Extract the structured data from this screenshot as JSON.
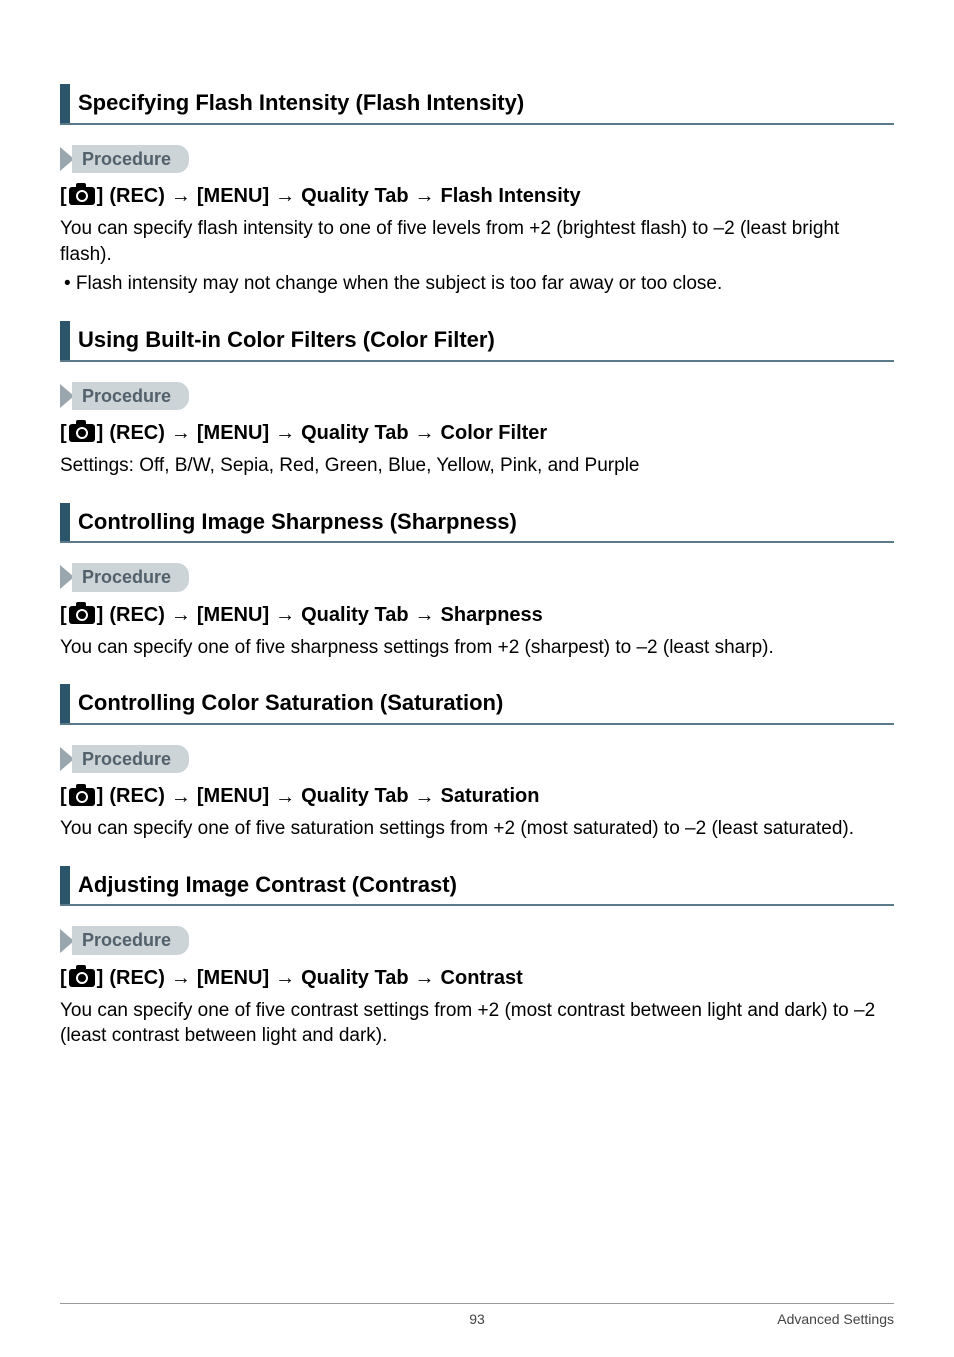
{
  "arrow": "→",
  "rec_bracket_open": "[",
  "rec_bracket_close": "]",
  "rec_label": "(REC)",
  "menu_label": "[MENU]",
  "quality_tab": "Quality Tab",
  "procedure_label": "Procedure",
  "sections": {
    "flash": {
      "title": "Specifying Flash Intensity (Flash Intensity)",
      "path_tail": "Flash Intensity",
      "body1": "You can specify flash intensity to one of five levels from +2 (brightest flash) to –2 (least bright flash).",
      "bullet1": "• Flash intensity may not change when the subject is too far away or too close."
    },
    "filter": {
      "title": "Using Built-in Color Filters (Color Filter)",
      "path_tail": "Color Filter",
      "body1": "Settings: Off, B/W, Sepia, Red, Green, Blue, Yellow, Pink, and Purple"
    },
    "sharp": {
      "title": "Controlling Image Sharpness (Sharpness)",
      "path_tail": "Sharpness",
      "body1": "You can specify one of five sharpness settings from +2 (sharpest) to –2 (least sharp)."
    },
    "sat": {
      "title": "Controlling Color Saturation (Saturation)",
      "path_tail": "Saturation",
      "body1": "You can specify one of five saturation settings from +2 (most saturated) to –2 (least saturated)."
    },
    "contrast": {
      "title": "Adjusting Image Contrast (Contrast)",
      "path_tail": "Contrast",
      "body1": "You can specify one of five contrast settings from +2 (most contrast between light and dark) to –2 (least contrast between light and dark)."
    }
  },
  "footer": {
    "page": "93",
    "right": "Advanced Settings"
  }
}
